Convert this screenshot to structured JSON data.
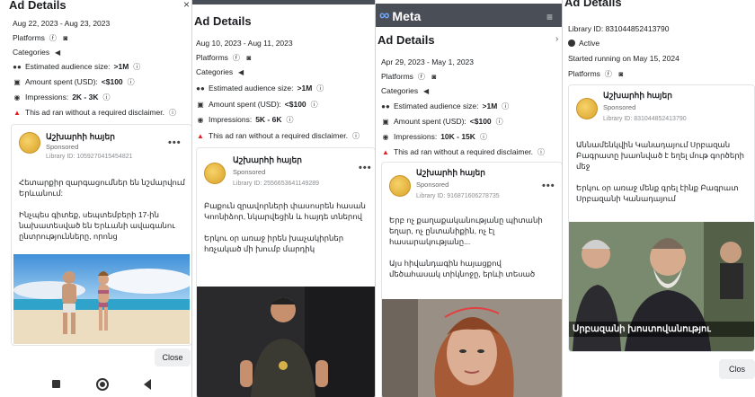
{
  "panel1": {
    "title": "Ad Details",
    "dates": "Aug 22, 2023 - Aug 23, 2023",
    "platforms_label": "Platforms",
    "categories_label": "Categories",
    "audience_label": "Estimated audience size: ",
    "audience_value": ">1M",
    "spent_label": "Amount spent (USD): ",
    "spent_value": "<$100",
    "impressions_label": "Impressions: ",
    "impressions_value": "2K - 3K",
    "disclaimer": "This ad ran without a required disclaimer.",
    "page_name": "Աշխարհի հայեր",
    "sponsored": "Sponsored",
    "library_id": "Library ID: 1059270415454821",
    "body": "Հետարքիր զարգացումներ են նշմարվում Երևանում:\n\nԻնչպես գիտեք, սեպտեմբերի 17-ին նախատեսված են Երևանի ավագանու ընտրությունները, որոնց",
    "close_label": "Close"
  },
  "panel2": {
    "title": "Ad Details",
    "dates": "Aug 10, 2023 - Aug 11, 2023",
    "platforms_label": "Platforms",
    "categories_label": "Categories",
    "audience_label": "Estimated audience size: ",
    "audience_value": ">1M",
    "spent_label": "Amount spent (USD): ",
    "spent_value": "<$100",
    "impressions_label": "Impressions: ",
    "impressions_value": "5K - 6K",
    "disclaimer": "This ad ran without a required disclaimer.",
    "page_name": "Աշխարհի հայեր",
    "sponsored": "Sponsored",
    "library_id": "Library ID: 2556653641149289",
    "body": "Բաքուն զրավորների փասոսրեն հասան Կոոնիձոր, նկարվեցին և հայդե տներով\n\nԵրկու օր առաջ իրեն խաչակիրներ հռչակած մի խումբ մարդիկ"
  },
  "panel3": {
    "brand": "Meta",
    "title": "Ad Details",
    "dates": "Apr 29, 2023 - May 1, 2023",
    "platforms_label": "Platforms",
    "categories_label": "Categories",
    "audience_label": "Estimated audience size: ",
    "audience_value": ">1M",
    "spent_label": "Amount spent (USD): ",
    "spent_value": "<$100",
    "impressions_label": "Impressions: ",
    "impressions_value": "10K - 15K",
    "disclaimer": "This ad ran without a required disclaimer.",
    "page_name": "Աշխարհի հայեր",
    "sponsored": "Sponsored",
    "library_id": "Library ID: 916871606278735",
    "body": "Երբ ոչ քաղաքականությանը պիտանի եղար, ոչ ընտանիքին, ոչ էլ հասարակությանը...\n\nԱյս հիվանդագին հայացքով մեծահասակ տիկնոջը, երևի տեսած"
  },
  "panel4": {
    "title": "Ad Details",
    "library_id_top": "Library ID: 831044852413790",
    "status": "Active",
    "started": "Started running on May 15, 2024",
    "platforms_label": "Platforms",
    "page_name": "Աշխարհի հայեր",
    "sponsored": "Sponsored",
    "library_id": "Library ID: 831044852413790",
    "body": "Աննամենկվին Կանադայում Սրբազան Բագրատը խաոնված է եղել մութ գործերի մեջ\n\nԵրկու օր առաջ մենք գրել էինք Բագրատ Սրբազանի Կանադայում",
    "caption": "Սրբազանի խոստովանությու",
    "close_label": "Clos"
  },
  "android_nav": [
    "square-icon",
    "home-circle-icon",
    "back-triangle-icon"
  ]
}
